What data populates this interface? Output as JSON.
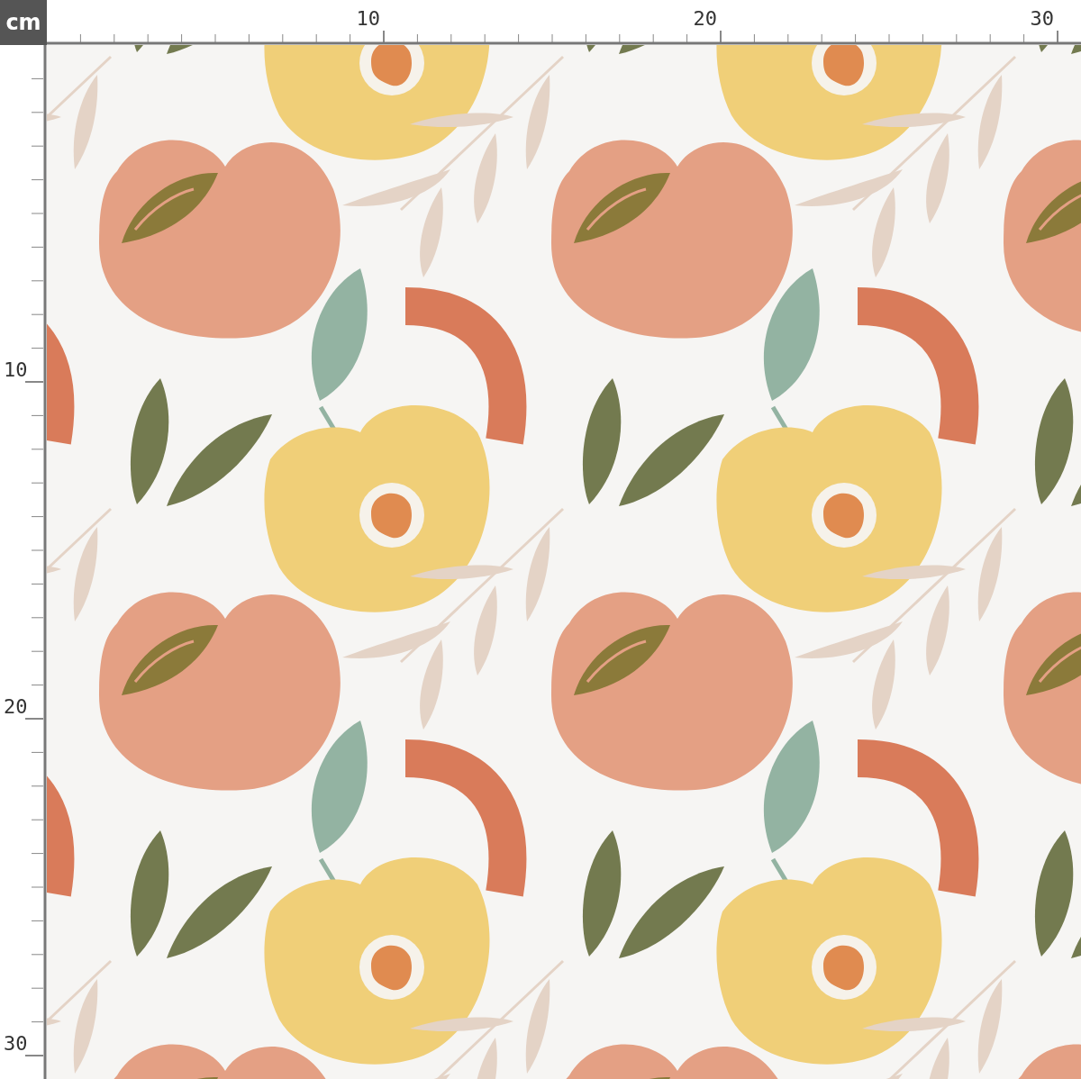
{
  "ruler_unit": "cm",
  "top_ruler": {
    "labels": [
      "10",
      "20",
      "30"
    ]
  },
  "left_ruler": {
    "labels": [
      "10",
      "20",
      "30"
    ]
  }
}
